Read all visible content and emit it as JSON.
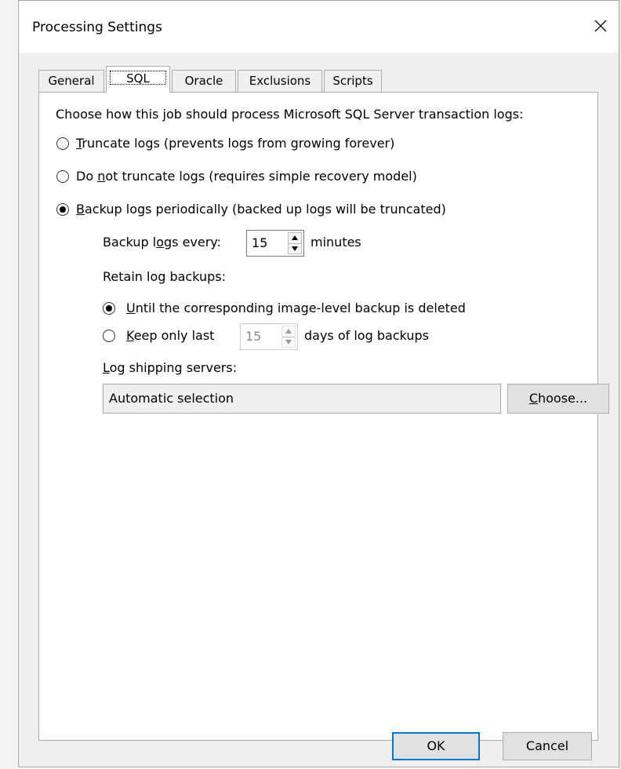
{
  "window": {
    "title": "Processing Settings",
    "close_icon": "close-icon"
  },
  "tabs": [
    {
      "label": "General",
      "active": false
    },
    {
      "label": "SQL",
      "active": true
    },
    {
      "label": "Oracle",
      "active": false
    },
    {
      "label": "Exclusions",
      "active": false
    },
    {
      "label": "Scripts",
      "active": false
    }
  ],
  "sql": {
    "heading": "Choose how this job should process Microsoft SQL Server transaction logs:",
    "options": [
      {
        "label": "Truncate logs (prevents logs from growing forever)",
        "mnemonic": "T",
        "selected": false
      },
      {
        "label": "Do not truncate logs (requires simple recovery model)",
        "mnemonic": "n",
        "selected": false
      },
      {
        "label": "Backup logs periodically (backed up logs will be truncated)",
        "mnemonic": "B",
        "selected": true
      }
    ],
    "backup_every": {
      "label": "Backup logs every:",
      "mnemonic": "o",
      "value": "15",
      "unit": "minutes"
    },
    "retain": {
      "heading": "Retain log backups:",
      "options": [
        {
          "label": "Until the corresponding image-level backup is deleted",
          "mnemonic": "U",
          "selected": true
        },
        {
          "label": "Keep only last",
          "mnemonic": "K",
          "selected": false
        }
      ],
      "keep_days_value": "15",
      "keep_days_suffix": "days of log backups"
    },
    "log_shipping": {
      "label": "Log shipping servers:",
      "mnemonic": "L",
      "value": "Automatic selection",
      "choose_label": "Choose...",
      "choose_mnemonic": "C"
    }
  },
  "footer": {
    "ok_label": "OK",
    "cancel_label": "Cancel"
  },
  "colors": {
    "dialog_bg": "#f0f0f0",
    "panel_bg": "#ffffff",
    "default_button_border": "#0078d7",
    "button_bg": "#e1e1e1"
  }
}
